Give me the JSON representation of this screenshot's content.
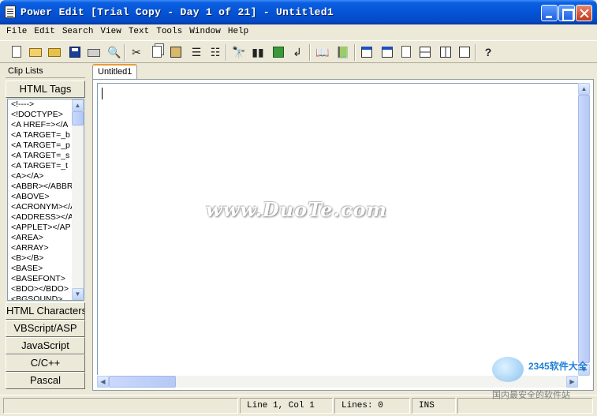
{
  "window": {
    "title": "Power Edit [Trial Copy - Day 1 of 21] - Untitled1",
    "minimize_icon": "minimize-icon",
    "maximize_icon": "maximize-icon",
    "close_icon": "close-icon"
  },
  "menu": [
    "File",
    "Edit",
    "Search",
    "View",
    "Text",
    "Tools",
    "Window",
    "Help"
  ],
  "toolbar": {
    "icons": [
      "new-document-icon",
      "open-folder-icon",
      "open-recent-icon",
      "save-icon",
      "print-icon",
      "print-preview-icon",
      "cut-icon",
      "copy-icon",
      "paste-icon",
      "indent-icon",
      "outdent-icon",
      "find-icon",
      "find-next-icon",
      "replace-icon",
      "goto-icon",
      "bookmark-icon",
      "bookmarks-list-icon",
      "window-cascade-icon",
      "window-next-icon",
      "document-icon",
      "split-horizontal-icon",
      "split-vertical-icon",
      "single-pane-icon",
      "help-icon"
    ]
  },
  "clip_panel": {
    "header": "Clip Lists",
    "active_category": "HTML Tags",
    "items": [
      "<!---->",
      "<!DOCTYPE>",
      "<A HREF=></A",
      "<A TARGET=_b",
      "<A TARGET=_p",
      "<A TARGET=_s",
      "<A TARGET=_t",
      "<A></A>",
      "<ABBR></ABBR",
      "<ABOVE>",
      "<ACRONYM></A",
      "<ADDRESS></A",
      "<APPLET></AP",
      "<AREA>",
      "<ARRAY>",
      "<B></B>",
      "<BASE>",
      "<BASEFONT>",
      "<BDO></BDO>",
      "<BGSOUND>"
    ],
    "categories": [
      "HTML Characters",
      "VBScript/ASP",
      "JavaScript",
      "C/C++",
      "Pascal"
    ]
  },
  "editor": {
    "tab_label": "Untitled1",
    "content": "",
    "watermark": "www.DuoTe.com"
  },
  "status": {
    "position": "Line 1, Col 1",
    "lines": "Lines: 0",
    "mode": "INS"
  },
  "overlay_logo": {
    "line1": "2345软件大全",
    "line2": "国内最安全的软件站"
  }
}
